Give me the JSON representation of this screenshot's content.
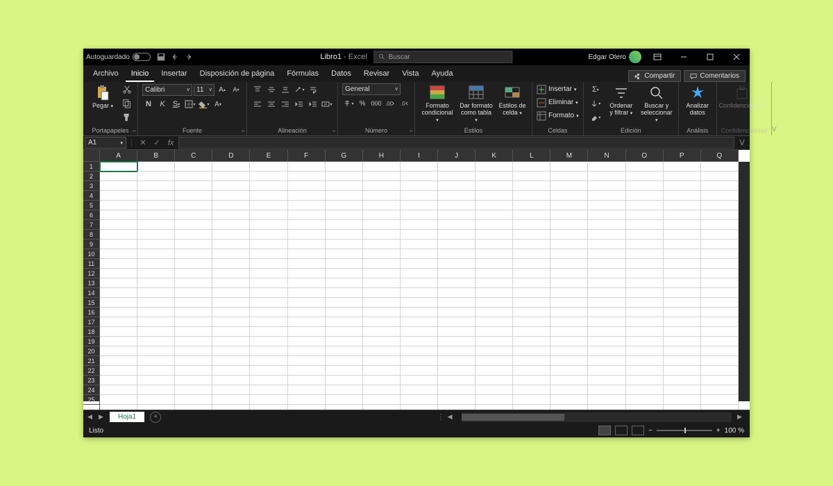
{
  "titlebar": {
    "autosave_label": "Autoguardado",
    "doc_name": "Libro1",
    "app_name": "Excel",
    "search_placeholder": "Buscar",
    "user_name": "Edgar Otero"
  },
  "menu": {
    "tabs": [
      "Archivo",
      "Inicio",
      "Insertar",
      "Disposición de página",
      "Fórmulas",
      "Datos",
      "Revisar",
      "Vista",
      "Ayuda"
    ],
    "active_index": 1,
    "share": "Compartir",
    "comments": "Comentarios"
  },
  "ribbon": {
    "clipboard": {
      "paste": "Pegar",
      "group": "Portapapeles"
    },
    "font": {
      "name": "Calibri",
      "size": "11",
      "bold": "N",
      "italic": "K",
      "underline": "S",
      "group": "Fuente"
    },
    "alignment": {
      "group": "Alineación"
    },
    "number": {
      "format": "General",
      "group": "Número"
    },
    "styles": {
      "conditional": "Formato condicional",
      "table": "Dar formato como tabla",
      "cell": "Estilos de celda",
      "group": "Estilos"
    },
    "cells": {
      "insert": "Insertar",
      "delete": "Eliminar",
      "format": "Formato",
      "group": "Celdas"
    },
    "editing": {
      "sort": "Ordenar y filtrar",
      "find": "Buscar y seleccionar",
      "group": "Edición"
    },
    "analysis": {
      "analyze": "Analizar datos",
      "group": "Análisis"
    },
    "sensitivity": {
      "label": "Confidencialidad",
      "group": "Confidencialidad"
    }
  },
  "fbar": {
    "cell": "A1"
  },
  "grid": {
    "columns": [
      "A",
      "B",
      "C",
      "D",
      "E",
      "F",
      "G",
      "H",
      "I",
      "J",
      "K",
      "L",
      "M",
      "N",
      "O",
      "P",
      "Q"
    ],
    "rows_visible": 27,
    "selected_cell": "A1"
  },
  "tabs": {
    "sheet": "Hoja1"
  },
  "status": {
    "ready": "Listo",
    "zoom": "100 %"
  }
}
